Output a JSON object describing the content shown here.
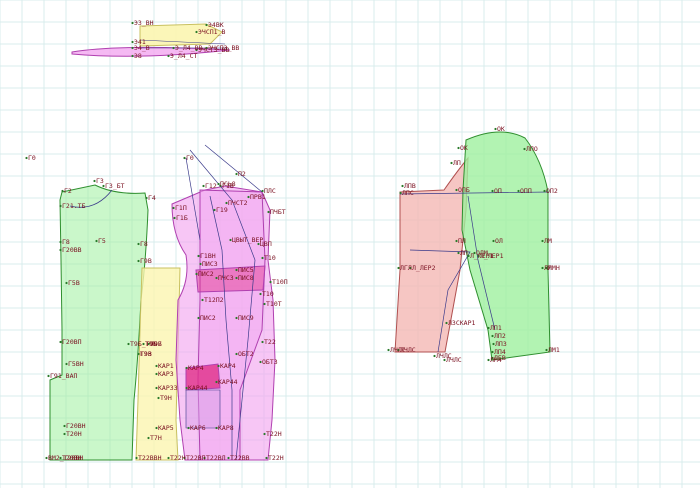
{
  "colors": {
    "grid": "#d9ecec",
    "green_fill": "#9ff09f",
    "green_stroke": "#2f8f2f",
    "yellow_fill": "#fbf5b0",
    "yellow_stroke": "#c8c060",
    "pink_fill": "#f3a8f0",
    "pink_stroke": "#b040b0",
    "magenta_fill": "#e0308a",
    "salmon_fill": "#f4b8b4",
    "salmon_stroke": "#b05050",
    "line_dark": "#3a3a8a",
    "label": "#7a1020"
  },
  "labels": {
    "top": [
      "Э3_ВН",
      "Э4ВК",
      "ЭЧСП1_В",
      "ЭЧСП3_ВВ",
      "Э41",
      "Э4_В",
      "Э_Л4_ВВ",
      "ЭЧСТ3_ВВ",
      "Э8",
      "Э_Л4_СТ"
    ],
    "back": [
      "Г0",
      "Г2",
      "Г3",
      "Г3_БТ",
      "Г4",
      "Г21.ТБ",
      "Г8",
      "Г5",
      "Г20ВВ",
      "Г8",
      "Г5В",
      "Г9В",
      "Г20ВП",
      "Г5ВН",
      "Г91_ВАП",
      "Т9Б_Т9Б",
      "Т9В",
      "Г20ВН",
      "Т20Н",
      "Т20ВН",
      "ВМ2_Т20ВН"
    ],
    "side": [
      "Т9Б",
      "Т9Б",
      "Т9Н",
      "Т7Н",
      "Т92",
      "ГЭЗ",
      "КАР1",
      "КАР3",
      "КАР33",
      "КАР5",
      "Т22ВВН",
      "Т22Н"
    ],
    "front": [
      "Г0",
      "Г12",
      "Г1В",
      "Г1П",
      "Г1Б",
      "П2",
      "ПСЬ8",
      "ПЧСТ2",
      "ПЛС",
      "ПЧБТ",
      "ПРВ1",
      "Г19",
      "ЦВЫТ_ВЕР",
      "ЦВП",
      "Т10",
      "Г1ВН",
      "ПИС3",
      "ПИС5",
      "ПИС2",
      "ПИС8",
      "ПЧСЗ",
      "Т10П",
      "Т10",
      "Т10Т",
      "Т12П2",
      "ПИС9",
      "ПИС2",
      "Т22",
      "КАР4",
      "КАР4",
      "ОБТ2",
      "ОБТ3",
      "КАР44",
      "КАР44",
      "КАР6",
      "КАР8",
      "Т22Н",
      "Т22ВП",
      "Т22ВЛ",
      "Т22ВВ",
      "Т22Н"
    ],
    "sleeve": [
      "ОК",
      "ЛПО",
      "ОК",
      "ЛП",
      "ЛПВ",
      "ЛПС",
      "ОПБ",
      "ОП",
      "ОПП",
      "ОП2",
      "ЛГЛ",
      "ПЛ",
      "ОЛ",
      "ЛМ",
      "ЛМ",
      "ОЛМ",
      "ЛП",
      "Л_ЛЕР2",
      "Л_ЛЕР1",
      "Л_ЛЕР1",
      "ЛМН",
      "ЛЗСКАР1",
      "ЛП1",
      "ЛП2",
      "ЛП3",
      "ЛП4",
      "ЛЧЛС",
      "ЛЧЛС",
      "ЛЧЛС",
      "ЛЧЛС",
      "ЛЕВ",
      "ЛМ1",
      "ЛМ4"
    ]
  }
}
